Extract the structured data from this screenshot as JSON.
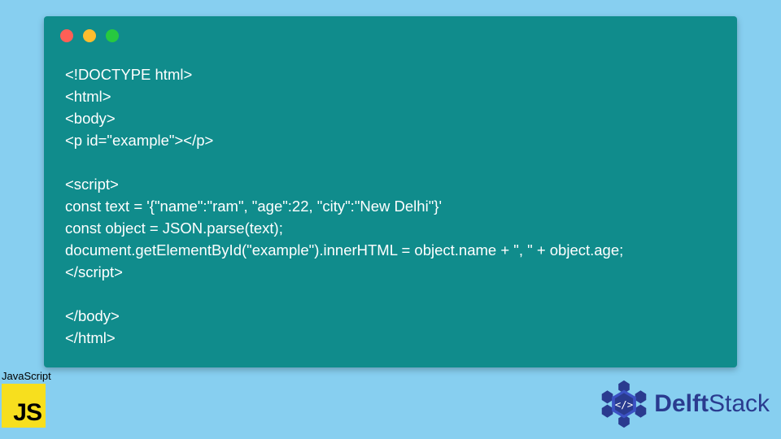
{
  "code": {
    "lines": [
      "<!DOCTYPE html>",
      "<html>",
      "<body>",
      "<p id=\"example\"></p>",
      "",
      "<script>",
      "const text = '{\"name\":\"ram\", \"age\":22, \"city\":\"New Delhi\"}'",
      "const object = JSON.parse(text);",
      "document.getElementById(\"example\").innerHTML = object.name + \", \" + object.age;",
      "</script>",
      "",
      "</body>",
      "</html>"
    ]
  },
  "badge": {
    "label": "JavaScript",
    "icon_text": "JS"
  },
  "brand": {
    "name_prefix": "Delft",
    "name_suffix": "Stack"
  },
  "colors": {
    "page_bg": "#87cff0",
    "window_bg": "#108c8c",
    "traffic_red": "#ff5f56",
    "traffic_yellow": "#ffbd2e",
    "traffic_green": "#27c93f",
    "js_yellow": "#f7df1e",
    "brand_blue": "#2a3b8f"
  }
}
